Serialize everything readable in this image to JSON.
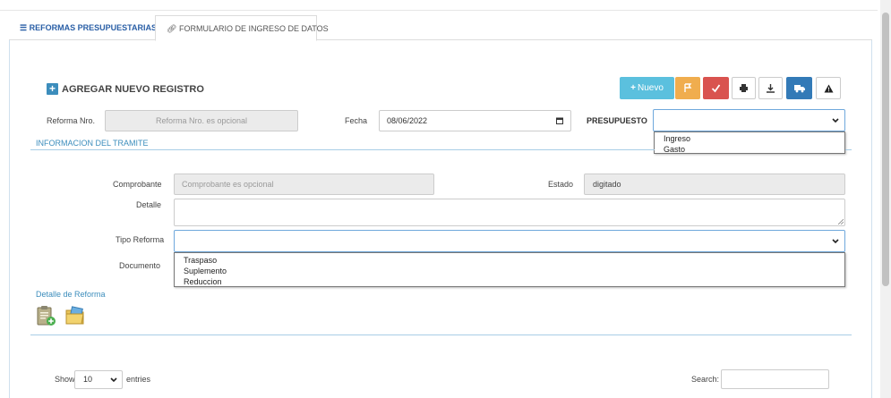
{
  "tabs": {
    "tab1_label": "REFORMAS PRESUPUESTARIAS",
    "tab2_label": "FORMULARIO DE INGRESO DE DATOS"
  },
  "header": {
    "title": "AGREGAR NUEVO REGISTRO"
  },
  "toolbar": {
    "nuevo_label": "Nuevo",
    "colors": {
      "nuevo": "#5bc0de",
      "warn": "#f0ad4e",
      "ok": "#d9534f",
      "truck": "#337ab7"
    }
  },
  "form": {
    "reforma_label": "Reforma Nro.",
    "reforma_placeholder": "Reforma Nro. es opcional",
    "fecha_label": "Fecha",
    "fecha_value": "08/06/2022",
    "presupuesto_label": "PRESUPUESTO",
    "presupuesto_options": [
      "Ingreso",
      "Gasto"
    ],
    "section_tramite": "INFORMACION DEL TRAMITE",
    "comprobante_label": "Comprobante",
    "comprobante_placeholder": "Comprobante es opcional",
    "estado_label": "Estado",
    "estado_value": "digitado",
    "detalle_label": "Detalle",
    "tipo_label": "Tipo Reforma",
    "tipo_options": [
      "Traspaso",
      "Suplemento",
      "Reduccion"
    ],
    "documento_label": "Documento"
  },
  "detalle": {
    "title": "Detalle de Reforma"
  },
  "table_controls": {
    "show_label": "Show",
    "entries_value": "10",
    "entries_label": "entries",
    "search_label": "Search:"
  }
}
